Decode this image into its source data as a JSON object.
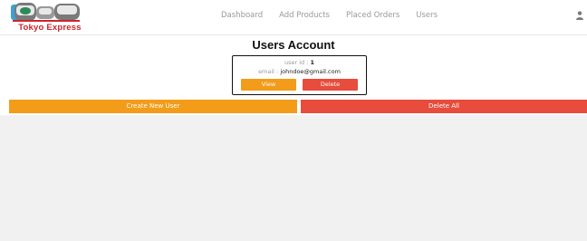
{
  "brand": {
    "name": "Tokyo Express",
    "accent_color": "#d0242b",
    "logo_icon": "train-logo-icon"
  },
  "nav": {
    "items": [
      {
        "label": "Dashboard"
      },
      {
        "label": "Add Products"
      },
      {
        "label": "Placed Orders"
      },
      {
        "label": "Users"
      }
    ],
    "user_icon": "user-icon"
  },
  "page": {
    "title": "Users Account"
  },
  "user_card": {
    "id_label": "user id : ",
    "id_value": "1",
    "email_label": "email : ",
    "email_value": "johndoe@gmail.com",
    "view_label": "View",
    "delete_label": "Delete"
  },
  "actions": {
    "create_label": "Create New User",
    "delete_all_label": "Delete All"
  },
  "colors": {
    "primary_orange": "#f39c1a",
    "danger_red": "#e74c3c",
    "content_bg": "#f1f1f1"
  }
}
